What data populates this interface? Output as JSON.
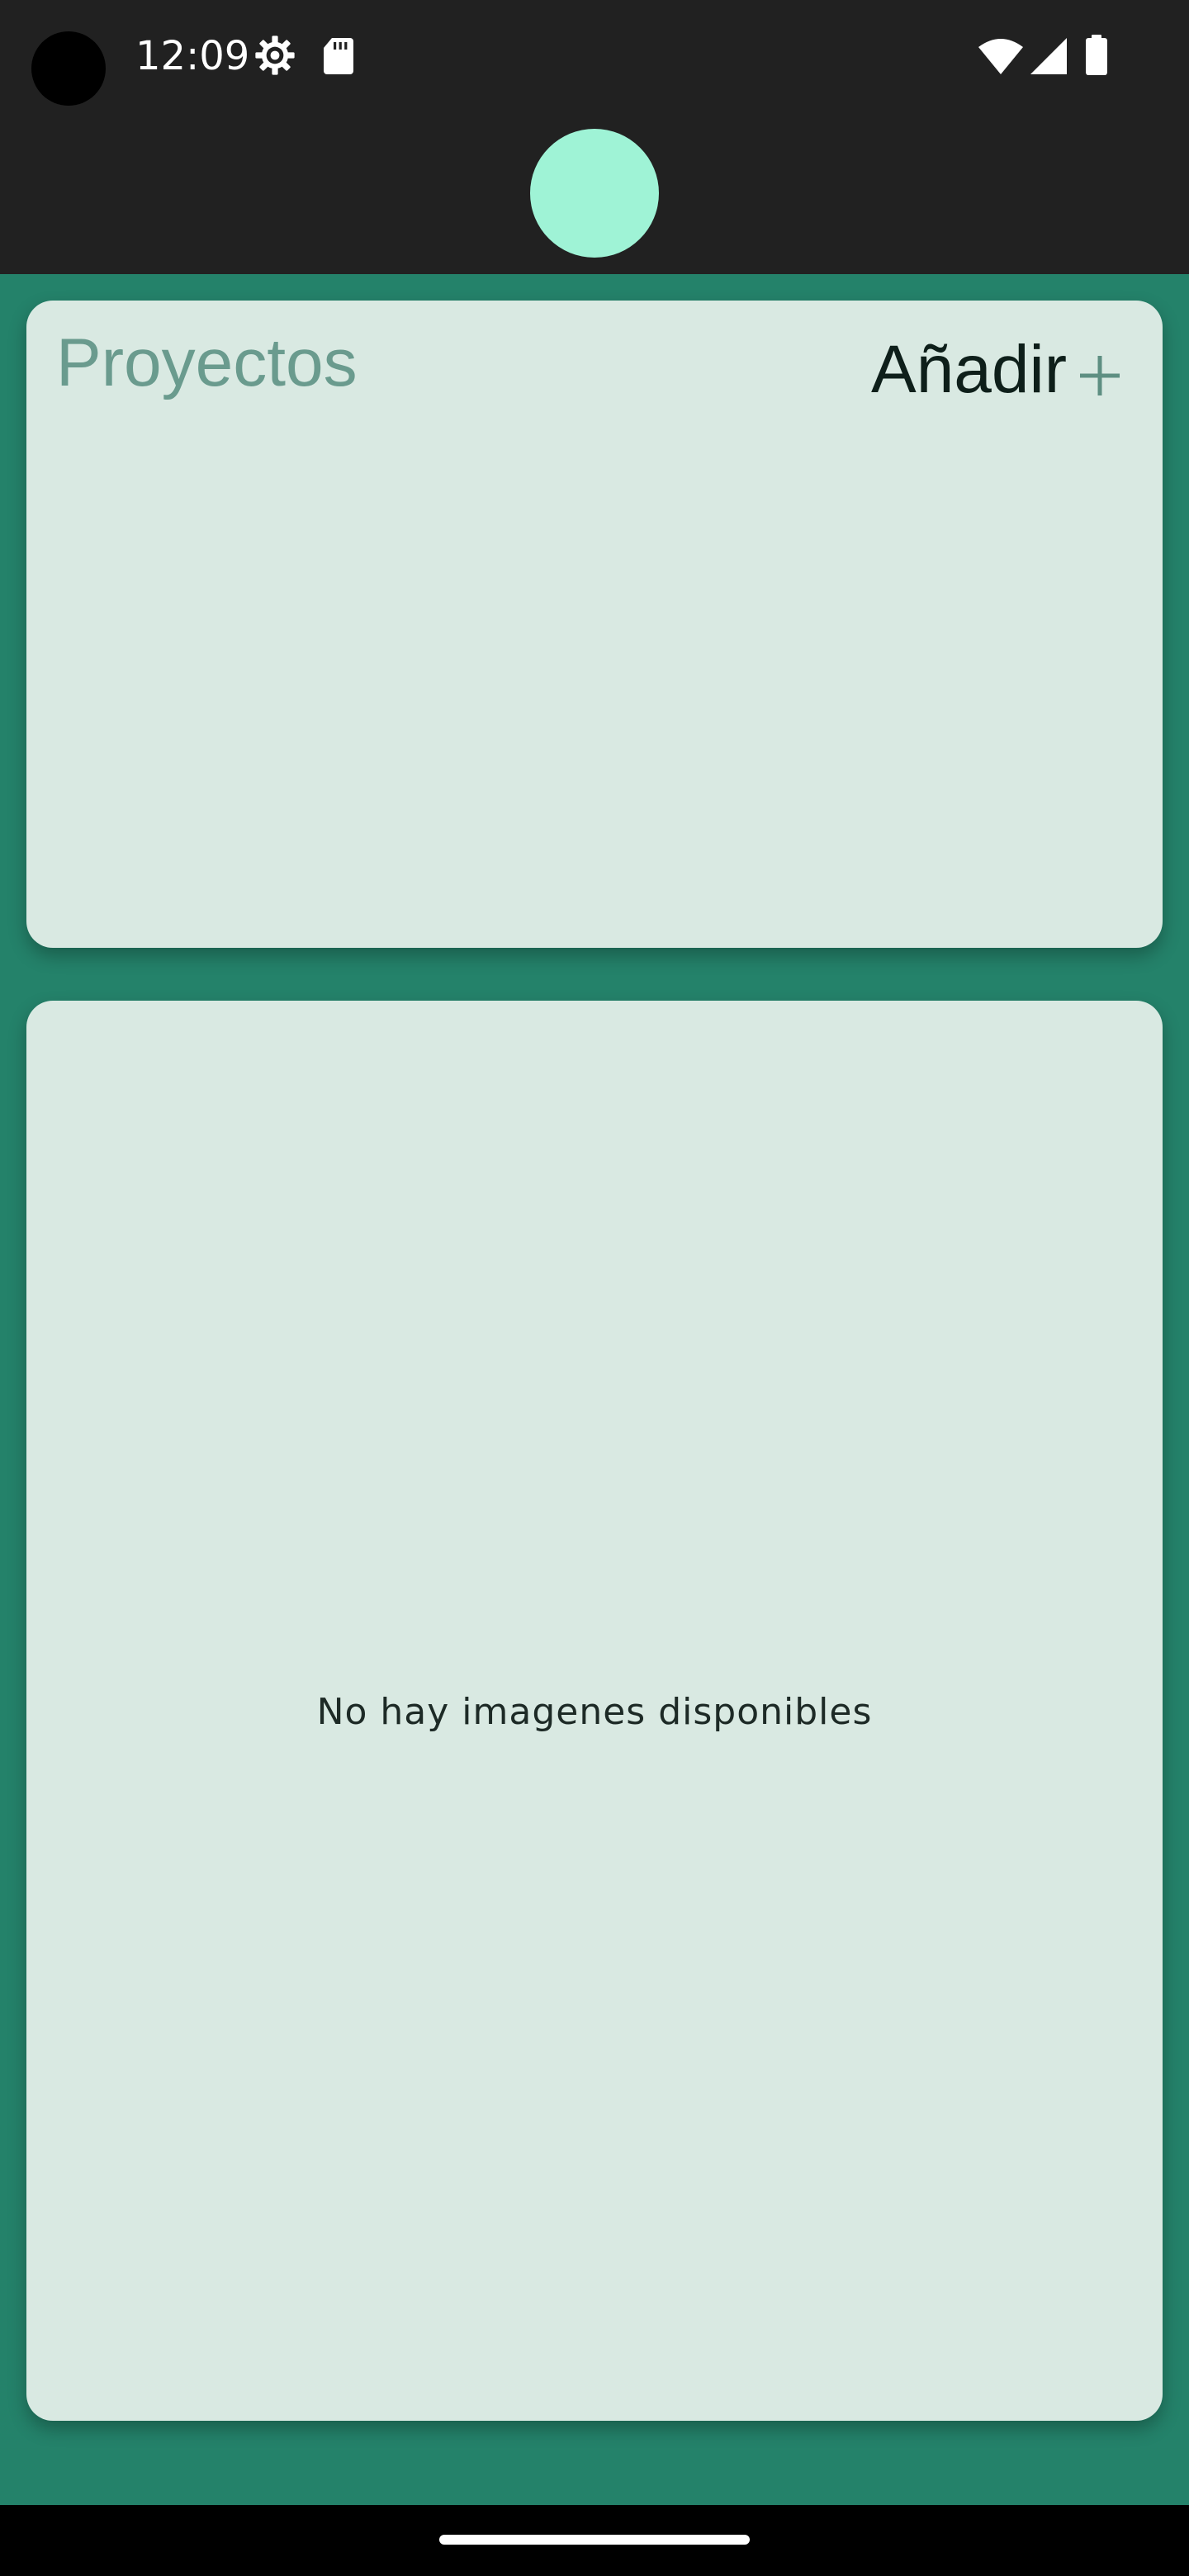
{
  "status_bar": {
    "time": "12:09",
    "icons": [
      "settings-gear-icon",
      "sd-card-icon",
      "wifi-icon",
      "cellular-signal-icon",
      "battery-icon"
    ]
  },
  "header": {
    "avatar_color": "#9ff3d6"
  },
  "projects_card": {
    "title": "Proyectos",
    "add_label": "Añadir",
    "add_icon": "plus-icon"
  },
  "images_card": {
    "empty_message": "No hay imagenes disponibles"
  },
  "colors": {
    "background": "#24826a",
    "card": "#d9e9e2",
    "title": "#6a9b8e",
    "accent_plus": "#5e8f82"
  }
}
